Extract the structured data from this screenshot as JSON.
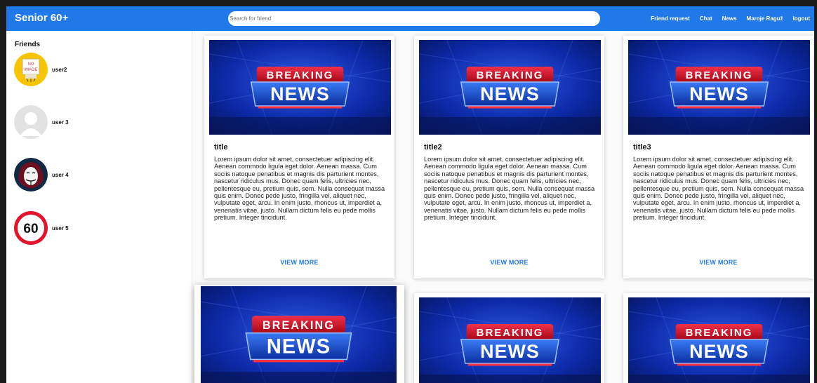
{
  "header": {
    "brand": "Senior 60+",
    "search_placeholder": "Search for friend",
    "nav": [
      "Friend request",
      "Chat",
      "News",
      "Maroje Raguž",
      "logout"
    ]
  },
  "sidebar": {
    "title": "Friends",
    "friends": [
      {
        "name": "user2",
        "avatar": "no-image-placeholder"
      },
      {
        "name": "user 3",
        "avatar": "default-person-silhouette"
      },
      {
        "name": "user 4",
        "avatar": "guy-fawkes-mask"
      },
      {
        "name": "user 5",
        "avatar": "speed-limit-60-sign"
      }
    ]
  },
  "news": {
    "image_line1": "BREAKING",
    "image_line2": "NEWS",
    "avatar_placeholder_line1": "NO",
    "avatar_placeholder_line2": "IMAGE",
    "avatar_speed_limit": "60",
    "view_more_label": "VIEW MORE",
    "cards": [
      {
        "title": "title",
        "body": "Lorem ipsum dolor sit amet, consectetuer adipiscing elit. Aenean commodo ligula eget dolor. Aenean massa. Cum sociis natoque penatibus et magnis dis parturient montes, nascetur ridiculus mus. Donec quam felis, ultricies nec, pellentesque eu, pretium quis, sem. Nulla consequat massa quis enim. Donec pede justo, fringilla vel, aliquet nec, vulputate eget, arcu. In enim justo, rhoncus ut, imperdiet a, venenatis vitae, justo. Nullam dictum felis eu pede mollis pretium. Integer tincidunt."
      },
      {
        "title": "title2",
        "body": "Lorem ipsum dolor sit amet, consectetuer adipiscing elit. Aenean commodo ligula eget dolor. Aenean massa. Cum sociis natoque penatibus et magnis dis parturient montes, nascetur ridiculus mus. Donec quam felis, ultricies nec, pellentesque eu, pretium quis, sem. Nulla consequat massa quis enim. Donec pede justo, fringilla vel, aliquet nec, vulputate eget, arcu. In enim justo, rhoncus ut, imperdiet a, venenatis vitae, justo. Nullam dictum felis eu pede mollis pretium. Integer tincidunt."
      },
      {
        "title": "title3",
        "body": "Lorem ipsum dolor sit amet, consectetuer adipiscing elit. Aenean commodo ligula eget dolor. Aenean massa. Cum sociis natoque penatibus et magnis dis parturient montes, nascetur ridiculus mus. Donec quam felis, ultricies nec, pellentesque eu, pretium quis, sem. Nulla consequat massa quis enim. Donec pede justo, fringilla vel, aliquet nec, vulputate eget, arcu. In enim justo, rhoncus ut, imperdiet a, venenatis vitae, justo. Nullam dictum felis eu pede mollis pretium. Integer tincidunt."
      },
      {
        "title": "",
        "body": ""
      },
      {
        "title": "",
        "body": ""
      },
      {
        "title": "",
        "body": ""
      }
    ]
  },
  "colors": {
    "accent": "#2178e8",
    "news_blue": "#0a2fb5",
    "news_red": "#d4102a"
  }
}
